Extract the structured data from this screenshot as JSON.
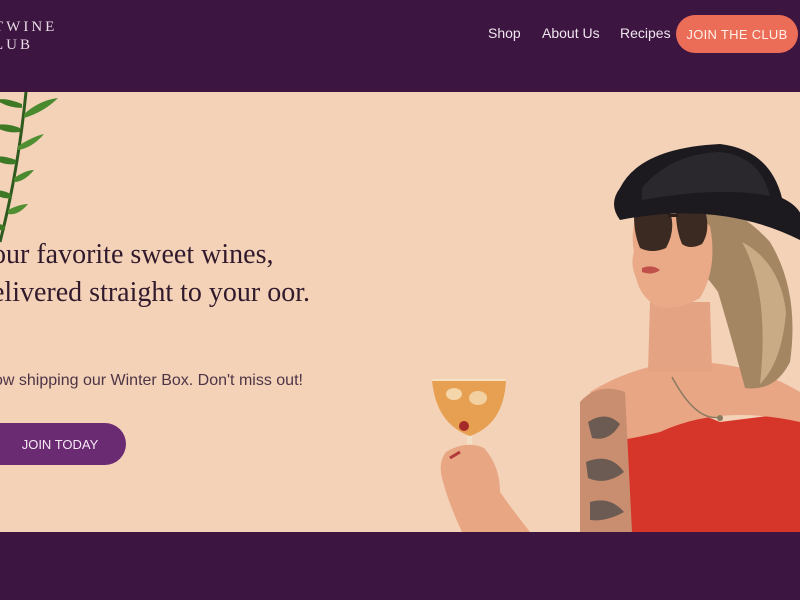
{
  "brand": {
    "line1": "TWINE",
    "line2": "LUB"
  },
  "nav": {
    "links": [
      {
        "label": "Shop"
      },
      {
        "label": "About Us"
      },
      {
        "label": "Recipes"
      }
    ],
    "cta_label": "JOIN THE CLUB"
  },
  "hero": {
    "headline": "our favorite sweet wines, elivered straight to your oor.",
    "subtext": "ow shipping our Winter Box. Don't miss out!",
    "button_label": "JOIN TODAY"
  },
  "colors": {
    "nav_bg": "#3c1540",
    "hero_bg": "#f3d2b8",
    "cta_bg": "#ec6d57",
    "button_bg": "#6b2b73"
  },
  "images": [
    "palm-leaf-decoration",
    "woman-holding-cocktail-photo"
  ]
}
